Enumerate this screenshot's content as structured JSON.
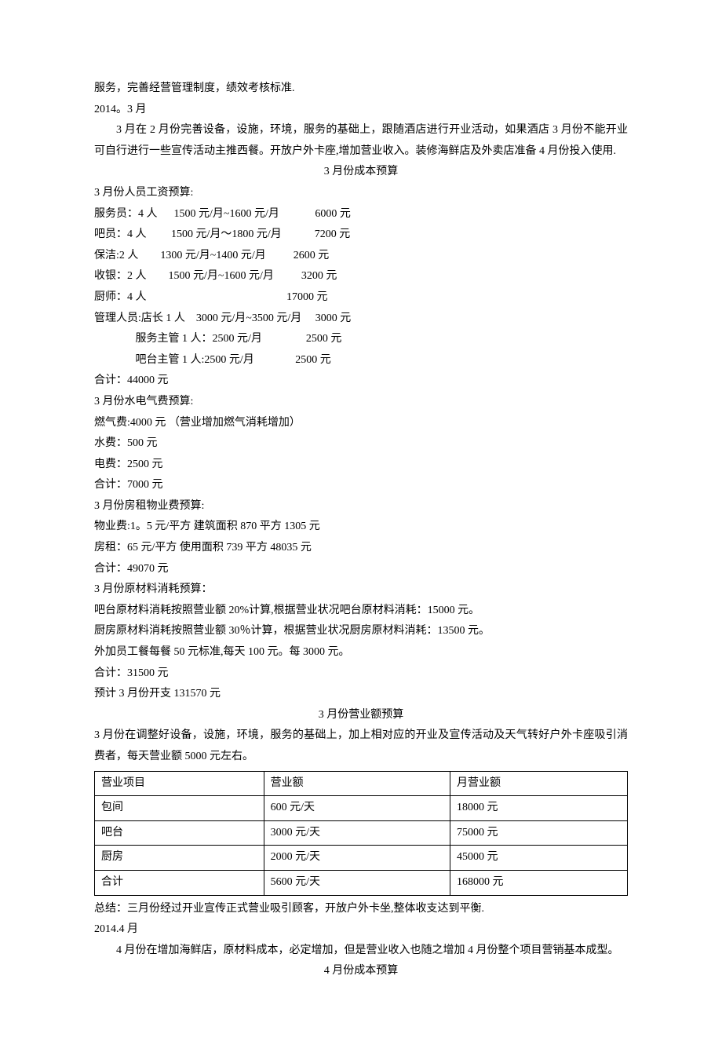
{
  "p1": "服务，完善经营管理制度，绩效考核标准.",
  "p2": "2014。3 月",
  "p3": "3 月在 2 月份完善设备，设施，环境，服务的基础上，跟随酒店进行开业活动，如果酒店 3 月份不能开业可自行进行一些宣传活动主推西餐。开放户外卡座,增加营业收入。装修海鲜店及外卖店准备 4 月份投入使用.",
  "h1": "3 月份成本预算",
  "s1": "3 月份人员工资预算:",
  "l1": "服务员：4 人      1500 元/月~1600 元/月             6000 元",
  "l2": "吧员：4 人         1500 元/月～1800 元/月            7200 元",
  "l3": "保洁:2 人        1300 元/月~1400 元/月          2600 元",
  "l4": "收银：2 人        1500 元/月~1600 元/月          3200 元",
  "l5": "厨师：4 人                                                   17000 元",
  "l6": "管理人员:店长 1 人    3000 元/月~3500 元/月     3000 元",
  "l7": "               服务主管 1 人：2500 元/月                2500 元",
  "l8": "               吧台主管 1 人:2500 元/月               2500 元",
  "l9": "合计：44000 元",
  "s2": "3 月份水电气费预算:",
  "l10": "燃气费:4000 元     （营业增加燃气消耗增加）",
  "l11": "水费：500 元",
  "l12": "电费：2500 元",
  "l13": "合计：7000 元",
  "s3": "3 月份房租物业费预算:",
  "l14": "物业费:1。5 元/平方    建筑面积 870 平方     1305 元",
  "l15": "房租：65 元/平方     使用面积 739 平方        48035 元",
  "l16": "合计：49070 元",
  "s4": "3 月份原材料消耗预算：",
  "l17": "吧台原材料消耗按照营业额 20%计算,根据营业状况吧台原材料消耗：15000 元。",
  "l18": "厨房原材料消耗按照营业额 30％计算，根据营业状况厨房原材料消耗：13500 元。",
  "l19": "外加员工餐每餐 50 元标准,每天 100 元。每 3000 元。",
  "l20": "合计：31500 元",
  "l21": "预计 3 月份开支 131570 元",
  "h2": "3 月份营业额预算",
  "p4": "3 月份在调整好设备，设施，环境，服务的基础上，加上相对应的开业及宣传活动及天气转好户外卡座吸引消费者，每天营业额 5000 元左右。",
  "table": {
    "header": [
      "营业项目",
      "营业额",
      "月营业额"
    ],
    "rows": [
      [
        "包间",
        "600 元/天",
        "18000 元"
      ],
      [
        "吧台",
        "3000 元/天",
        "75000 元"
      ],
      [
        "厨房",
        "2000 元/天",
        "45000 元"
      ],
      [
        "合计",
        "5600 元/天",
        "168000 元"
      ]
    ]
  },
  "p5": "总结：三月份经过开业宣传正式营业吸引顾客，开放户外卡坐,整体收支达到平衡.",
  "p6": "2014.4 月",
  "p7": "4 月份在增加海鲜店，原材料成本，必定增加，但是营业收入也随之增加 4 月份整个项目营销基本成型。",
  "h3": "4 月份成本预算"
}
